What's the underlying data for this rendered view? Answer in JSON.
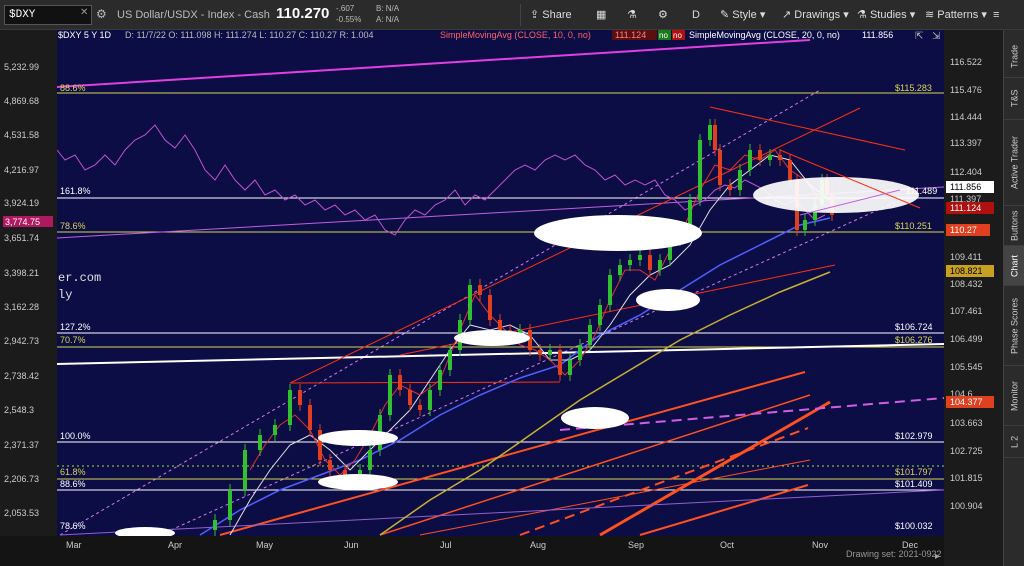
{
  "toolbar": {
    "symbol": "$DXY",
    "title": "US Dollar/USDX - Index - Cash",
    "last": "110.270",
    "change": "-.607",
    "change_pct": "-0.55%",
    "bid": "B: N/A",
    "ask": "A: N/A",
    "share": "Share",
    "timeframe": "D",
    "style": "Style",
    "drawings": "Drawings",
    "studies": "Studies",
    "patterns": "Patterns"
  },
  "chart_header": {
    "symbol_info": "$DXY 5 Y 1D",
    "ohlc": "D: 11/7/22  O: 111.098  H: 111.274  L: 110.27  C: 110.27  R: 1.004",
    "sma10_label": "SimpleMovingAvg (CLOSE, 10, 0, no)",
    "sma10_value": "111.124",
    "sma20_label": "SimpleMovingAvg (CLOSE, 20, 0, no)",
    "sma20_value": "111.856",
    "no_flag": "no"
  },
  "left_axis": [
    "5,232.99",
    "4,869.68",
    "4,531.58",
    "4,216.97",
    "3,924.19",
    "3,774.75",
    "3,651.74",
    "3,398.21",
    "3,162.28",
    "2,942.73",
    "2,738.42",
    "2,548.3",
    "2,371.37",
    "2,206.73",
    "2,053.53"
  ],
  "right_axis": [
    "116.522",
    "115.476",
    "114.444",
    "113.397",
    "112.404",
    "111.397",
    "110.27",
    "109.411",
    "108.821",
    "108.432",
    "107.461",
    "106.499",
    "105.545",
    "104.6",
    "104.377",
    "103.663",
    "102.725",
    "101.815",
    "100.904"
  ],
  "price_flags": {
    "sma20": "111.856",
    "sma10": "111.124",
    "last": "110.27",
    "sma50": "108.821",
    "sma200": "104.377",
    "left_marker": "3,774.75"
  },
  "levels": [
    {
      "pct": "88.6%",
      "value": "$115.283"
    },
    {
      "pct": "161.8%",
      "value": "111.489"
    },
    {
      "pct": "78.6%",
      "value": "$110.251"
    },
    {
      "pct": "127.2%",
      "value": "$106.724"
    },
    {
      "pct": "70.7%",
      "value": "$106.276"
    },
    {
      "pct": "100.0%",
      "value": "$102.979"
    },
    {
      "pct": "61.8%",
      "value": "$101.797"
    },
    {
      "pct": "88.6%",
      "value": "$101.409"
    },
    {
      "pct": "78.6%",
      "value": "$100.032"
    }
  ],
  "watermark": [
    "er.com",
    "ly"
  ],
  "months": [
    "Mar",
    "Apr",
    "May",
    "Jun",
    "Jul",
    "Aug",
    "Sep",
    "Oct",
    "Nov",
    "Dec"
  ],
  "side_tabs": [
    "Trade",
    "T&S",
    "Active Trader",
    "Buttons",
    "Chart",
    "Phase Scores",
    "Monitor",
    "L 2"
  ],
  "drawing_set": "Drawing set: 2021-0922"
}
